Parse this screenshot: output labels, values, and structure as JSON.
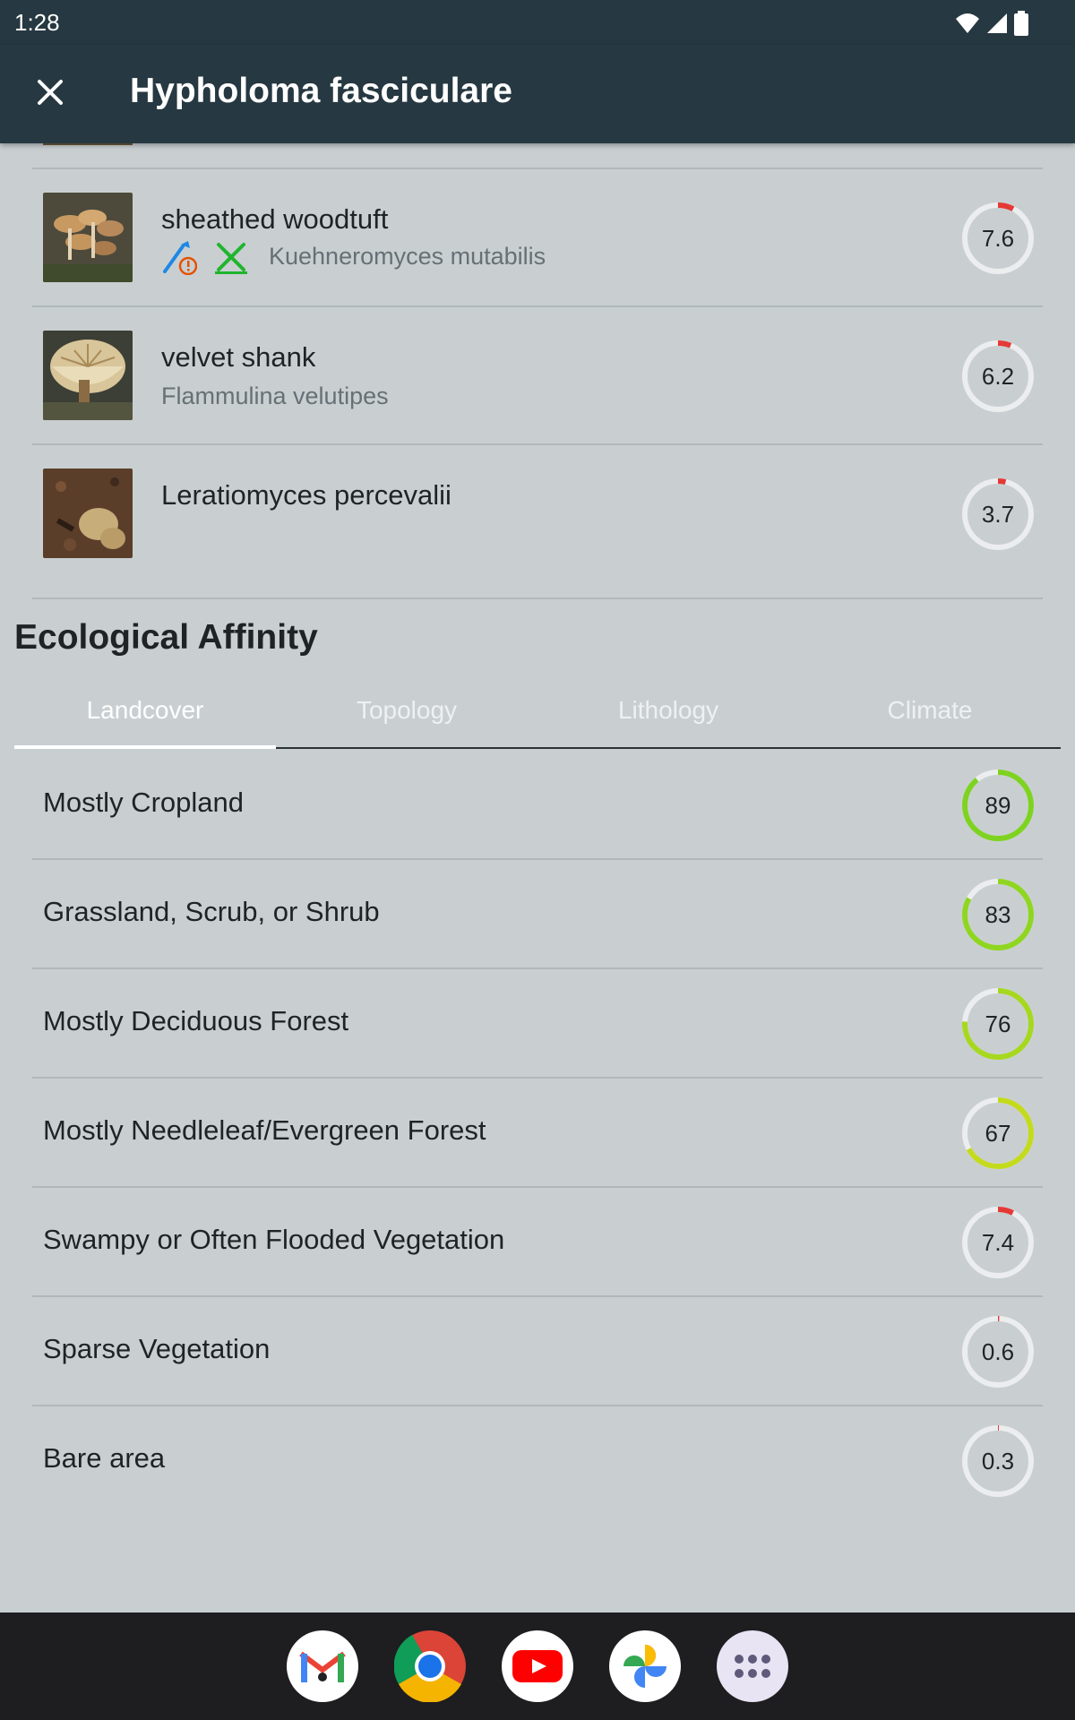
{
  "status": {
    "time": "1:28"
  },
  "appbar": {
    "title": "Hypholoma fasciculare",
    "close_icon": "close-icon"
  },
  "similar": [
    {
      "name": "sheathed woodtuft",
      "scientific": "Kuehneromyces mutabilis",
      "score": "7.6",
      "fraction": 0.076,
      "icons": [
        "edible-caution-icon",
        "edible-icon"
      ],
      "ring_color": "#e53935"
    },
    {
      "name": "velvet shank",
      "scientific": "Flammulina velutipes",
      "score": "6.2",
      "fraction": 0.062,
      "ring_color": "#e53935"
    },
    {
      "name": "Leratiomyces percevalii",
      "scientific": "",
      "score": "3.7",
      "fraction": 0.037,
      "ring_color": "#e53935"
    }
  ],
  "ecology": {
    "title": "Ecological Affinity",
    "tabs": [
      "Landcover",
      "Topology",
      "Lithology",
      "Climate"
    ],
    "active_tab": "Landcover",
    "rows": [
      {
        "label": "Mostly Cropland",
        "score": "89",
        "fraction": 0.89,
        "ring_color": "#7ed321"
      },
      {
        "label": "Grassland, Scrub, or Shrub",
        "score": "83",
        "fraction": 0.83,
        "ring_color": "#8fd620"
      },
      {
        "label": "Mostly Deciduous Forest",
        "score": "76",
        "fraction": 0.76,
        "ring_color": "#a6d81f"
      },
      {
        "label": "Mostly Needleleaf/Evergreen Forest",
        "score": "67",
        "fraction": 0.67,
        "ring_color": "#c3db1c"
      },
      {
        "label": "Swampy or Often Flooded Vegetation",
        "score": "7.4",
        "fraction": 0.074,
        "ring_color": "#e53935"
      },
      {
        "label": "Sparse Vegetation",
        "score": "0.6",
        "fraction": 0.006,
        "ring_color": "#e53935"
      },
      {
        "label": "Bare area",
        "score": "0.3",
        "fraction": 0.003,
        "ring_color": "#e53935"
      }
    ]
  },
  "dock": [
    "gmail-icon",
    "chrome-icon",
    "youtube-icon",
    "photos-icon",
    "apps-icon"
  ]
}
